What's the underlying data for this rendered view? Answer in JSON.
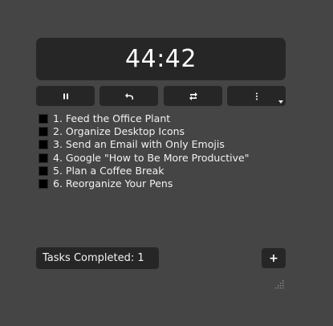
{
  "timer": {
    "display": "44:42"
  },
  "controls": [
    {
      "name": "pause",
      "icon": "pause-icon"
    },
    {
      "name": "undo",
      "icon": "undo-arrow-icon"
    },
    {
      "name": "repeat",
      "icon": "repeat-icon"
    },
    {
      "name": "menu",
      "icon": "vertical-ellipsis-icon"
    }
  ],
  "tasks": [
    {
      "label": "1. Feed the Office Plant",
      "checked": false
    },
    {
      "label": "2. Organize Desktop Icons",
      "checked": false
    },
    {
      "label": "3. Send an Email with Only Emojis",
      "checked": false
    },
    {
      "label": "4. Google \"How to Be More Productive\"",
      "checked": false
    },
    {
      "label": "5. Plan a Coffee Break",
      "checked": false
    },
    {
      "label": "6. Reorganize Your Pens",
      "checked": false
    }
  ],
  "footer": {
    "tasks_completed": "Tasks Completed: 1",
    "add_label": "+"
  },
  "colors": {
    "background": "#454545",
    "panel": "#262626",
    "text": "#ffffff",
    "checkbox": "#000000"
  }
}
